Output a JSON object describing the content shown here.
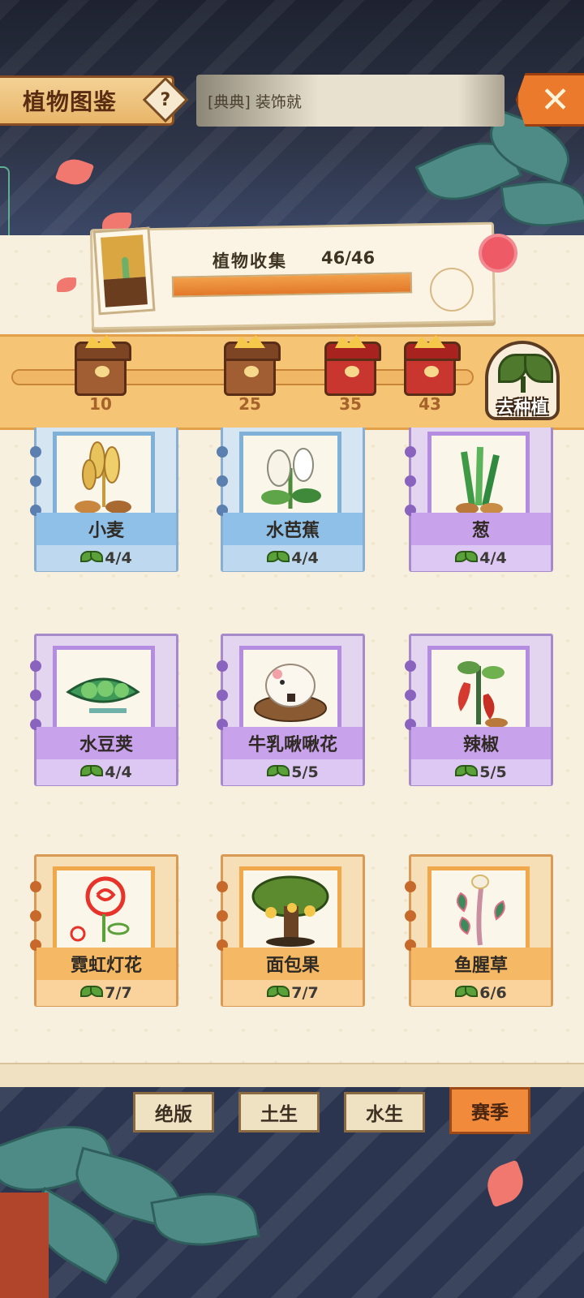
{
  "header": {
    "title": "植物图鉴",
    "help_label": "?",
    "search_text": "[典典] 装饰就",
    "close_label": "✕"
  },
  "collection": {
    "title": "植物收集",
    "count": "46/46",
    "progress": 1.0
  },
  "milestones": {
    "items": [
      {
        "label": "10",
        "style": "brown"
      },
      {
        "label": "25",
        "style": "brown"
      },
      {
        "label": "35",
        "style": "red"
      },
      {
        "label": "43",
        "style": "red"
      }
    ],
    "progress": 1.0,
    "plant_button_label": "去种植"
  },
  "plants": [
    {
      "name": "小麦",
      "count": "4/4",
      "theme": "blue",
      "icon": "wheat-icon"
    },
    {
      "name": "水芭蕉",
      "count": "4/4",
      "theme": "blue",
      "icon": "calla-lily-icon"
    },
    {
      "name": "葱",
      "count": "4/4",
      "theme": "purple",
      "icon": "scallion-icon"
    },
    {
      "name": "水豆荚",
      "count": "4/4",
      "theme": "purple",
      "icon": "pea-pod-icon"
    },
    {
      "name": "牛乳啾啾花",
      "count": "5/5",
      "theme": "purple",
      "icon": "bird-flower-icon"
    },
    {
      "name": "辣椒",
      "count": "5/5",
      "theme": "purple",
      "icon": "chili-icon"
    },
    {
      "name": "霓虹灯花",
      "count": "7/7",
      "theme": "orange",
      "icon": "neon-rose-icon"
    },
    {
      "name": "面包果",
      "count": "7/7",
      "theme": "orange",
      "icon": "breadfruit-tree-icon"
    },
    {
      "name": "鱼腥草",
      "count": "6/6",
      "theme": "orange",
      "icon": "houttuynia-icon"
    }
  ],
  "tabs": [
    {
      "label": "绝版",
      "active": false
    },
    {
      "label": "土生",
      "active": false
    },
    {
      "label": "水生",
      "active": false
    },
    {
      "label": "赛季",
      "active": true
    }
  ],
  "colors": {
    "accent_orange": "#f28a3c",
    "progress_orange": "#e2792a",
    "panel_bg": "#f7f0df"
  }
}
